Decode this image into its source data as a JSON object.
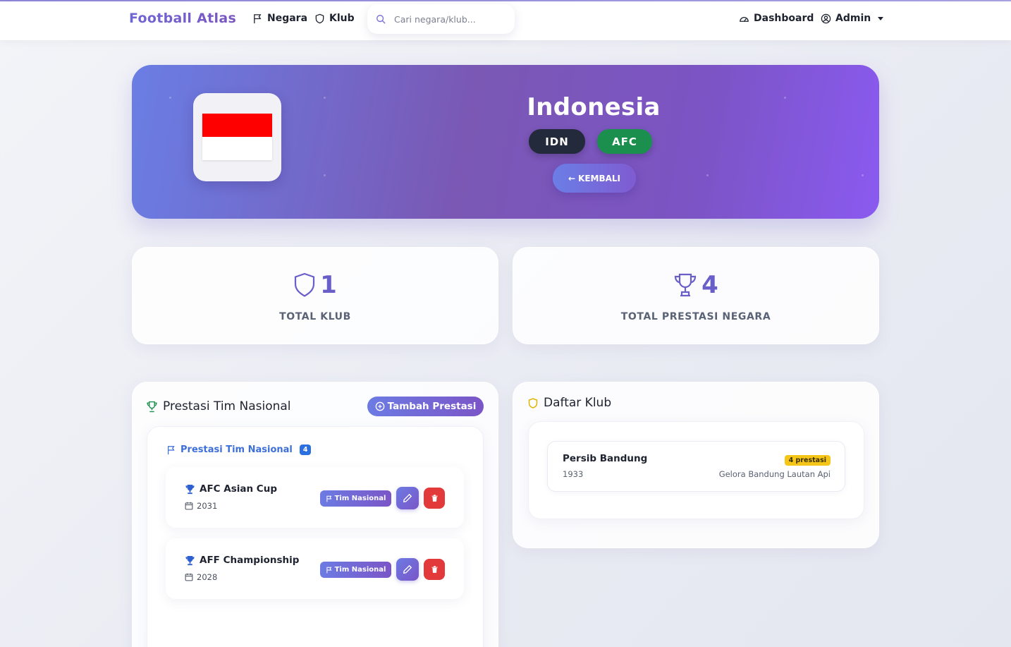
{
  "navbar": {
    "brand": "Football Atlas",
    "links": {
      "negara": "Negara",
      "klub": "Klub"
    },
    "search": {
      "placeholder": "Cari negara/klub...",
      "value": ""
    },
    "dashboard": "Dashboard",
    "user": "Admin"
  },
  "hero": {
    "country": "Indonesia",
    "code": "IDN",
    "confederation": "AFC",
    "back_label": "KEMBALI",
    "flag_colors": [
      "#ff0000",
      "#ffffff"
    ]
  },
  "stats": {
    "total_klub": {
      "value": "1",
      "label": "TOTAL KLUB"
    },
    "total_prestasi": {
      "value": "4",
      "label": "TOTAL PRESTASI NEGARA"
    }
  },
  "prestasi_panel": {
    "title": "Prestasi Tim Nasional",
    "add_label": "Tambah Prestasi",
    "section_title": "Prestasi Tim Nasional",
    "count": "4",
    "items": [
      {
        "name": "AFC Asian Cup",
        "year": "2031",
        "tag": "Tim Nasional"
      },
      {
        "name": "AFF Championship",
        "year": "2028",
        "tag": "Tim Nasional"
      }
    ]
  },
  "klub_panel": {
    "title": "Daftar Klub",
    "clubs": [
      {
        "name": "Persib Bandung",
        "founded": "1933",
        "badge": "4 prestasi",
        "stadium": "Gelora Bandung Lautan Api"
      }
    ]
  },
  "colors": {
    "accent": "#6a5fc8",
    "hero_start": "#6a7ee4",
    "hero_end": "#8a5af0",
    "conf_badge": "#1b8f4d",
    "code_badge": "#232a3b",
    "delete": "#e23a3a",
    "prestasi_badge": "#f5c518"
  }
}
